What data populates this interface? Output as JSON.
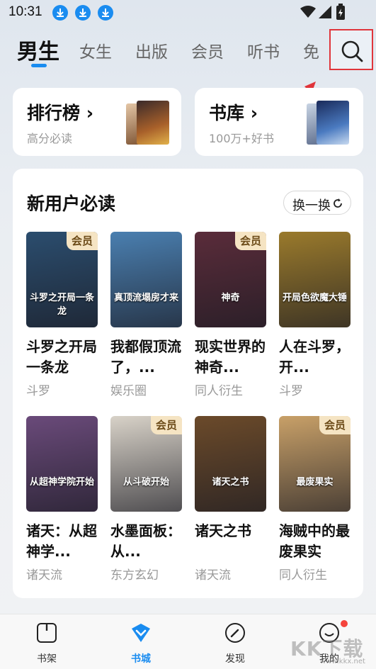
{
  "status_bar": {
    "time": "10:31"
  },
  "tabs": [
    {
      "label": "男生"
    },
    {
      "label": "女生"
    },
    {
      "label": "出版"
    },
    {
      "label": "会员"
    },
    {
      "label": "听书"
    },
    {
      "label": "免"
    }
  ],
  "entries": [
    {
      "title": "排行榜 ›",
      "subtitle": "高分必读"
    },
    {
      "title": "书库 ›",
      "subtitle": "100万+好书"
    }
  ],
  "panel": {
    "title": "新用户必读",
    "refresh_label": "换一换"
  },
  "vip_label": "会员",
  "books": [
    {
      "title": "斗罗之开局一条龙",
      "category": "斗罗",
      "vip": true,
      "cover_text": "斗罗之开局一条龙",
      "cover_color": "#2b4d6e"
    },
    {
      "title": "我都假顶流了，...",
      "category": "娱乐圈",
      "vip": false,
      "cover_text": "真顶流塌房才来",
      "cover_color": "#4a7fb0"
    },
    {
      "title": "现实世界的神奇...",
      "category": "同人衍生",
      "vip": true,
      "cover_text": "神奇",
      "cover_color": "#5a2c3a"
    },
    {
      "title": "人在斗罗，开...",
      "category": "斗罗",
      "vip": false,
      "cover_text": "开局色欲魔大锤",
      "cover_color": "#9a7a2c"
    },
    {
      "title": "诸天：从超神学...",
      "category": "诸天流",
      "vip": false,
      "cover_text": "从超神学院开始",
      "cover_color": "#6a4a7a"
    },
    {
      "title": "水墨面板：从...",
      "category": "东方玄幻",
      "vip": true,
      "cover_text": "从斗破开始",
      "cover_color": "#d8d2c8"
    },
    {
      "title": "诸天之书",
      "category": "诸天流",
      "vip": false,
      "cover_text": "诸天之书",
      "cover_color": "#6b4a2a"
    },
    {
      "title": "海贼中的最废果实",
      "category": "同人衍生",
      "vip": true,
      "cover_text": "最废果实",
      "cover_color": "#c8a068"
    }
  ],
  "bottom_nav": [
    {
      "label": "书架",
      "active": false
    },
    {
      "label": "书城",
      "active": true
    },
    {
      "label": "发现",
      "active": false
    },
    {
      "label": "我的",
      "active": false
    }
  ],
  "watermark": "KK下载",
  "watermark_url": "www.kkx.net",
  "colors": {
    "accent": "#1a8cf0",
    "highlight": "#e0353b",
    "vip_bg": "#f5e4c3"
  }
}
